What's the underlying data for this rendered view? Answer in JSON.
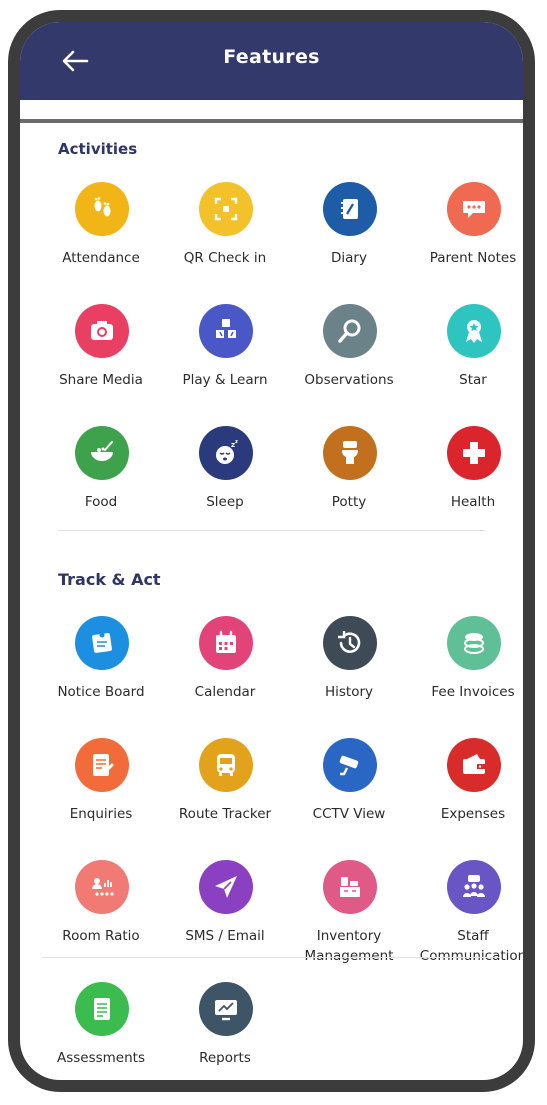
{
  "header": {
    "title": "Features"
  },
  "sections": {
    "activities": {
      "title": "Activities",
      "items": [
        {
          "label": "Attendance",
          "icon": "footprints-icon",
          "color": "#f1b517"
        },
        {
          "label": "QR Check in",
          "icon": "qr-scan-icon",
          "color": "#f3c12a"
        },
        {
          "label": "Diary",
          "icon": "notebook-icon",
          "color": "#1f5ca8"
        },
        {
          "label": "Parent Notes",
          "icon": "chat-bubble-icon",
          "color": "#ef6a50"
        },
        {
          "label": "Share Media",
          "icon": "camera-icon",
          "color": "#e83f63"
        },
        {
          "label": "Play & Learn",
          "icon": "blocks-icon",
          "color": "#4a57c6"
        },
        {
          "label": "Observations",
          "icon": "magnifier-icon",
          "color": "#6c8289"
        },
        {
          "label": "Star",
          "icon": "award-icon",
          "color": "#2ec5c1"
        },
        {
          "label": "Food",
          "icon": "food-bowl-icon",
          "color": "#3ea14b"
        },
        {
          "label": "Sleep",
          "icon": "sleeping-face-icon",
          "color": "#2b3a7d"
        },
        {
          "label": "Potty",
          "icon": "toilet-icon",
          "color": "#c2701d"
        },
        {
          "label": "Health",
          "icon": "medical-cross-icon",
          "color": "#d9252b"
        }
      ]
    },
    "track": {
      "title": "Track & Act",
      "items": [
        {
          "label": "Notice Board",
          "icon": "notice-board-icon",
          "color": "#1c8fe1"
        },
        {
          "label": "Calendar",
          "icon": "calendar-icon",
          "color": "#e2447a"
        },
        {
          "label": "History",
          "icon": "history-clock-icon",
          "color": "#3e4a55"
        },
        {
          "label": "Fee Invoices",
          "icon": "coins-icon",
          "color": "#5fbf96"
        },
        {
          "label": "Enquiries",
          "icon": "enquiry-form-icon",
          "color": "#f26b3a"
        },
        {
          "label": "Route Tracker",
          "icon": "bus-icon",
          "color": "#e2a21b"
        },
        {
          "label": "CCTV View",
          "icon": "cctv-camera-icon",
          "color": "#2a66c3"
        },
        {
          "label": "Expenses",
          "icon": "wallet-icon",
          "color": "#d82c2a"
        },
        {
          "label": "Room Ratio",
          "icon": "room-ratio-icon",
          "color": "#f17a74"
        },
        {
          "label": "SMS / Email",
          "icon": "paper-plane-icon",
          "color": "#8b3fc1"
        },
        {
          "label": "Inventory\nManagement",
          "icon": "inventory-boxes-icon",
          "color": "#e05a87"
        },
        {
          "label": "Staff\nCommunication",
          "icon": "staff-group-icon",
          "color": "#6a55c5"
        },
        {
          "label": "Assessments",
          "icon": "assessment-sheet-icon",
          "color": "#3cbc4f"
        },
        {
          "label": "Reports",
          "icon": "monitor-chart-icon",
          "color": "#3d5566"
        }
      ]
    }
  }
}
